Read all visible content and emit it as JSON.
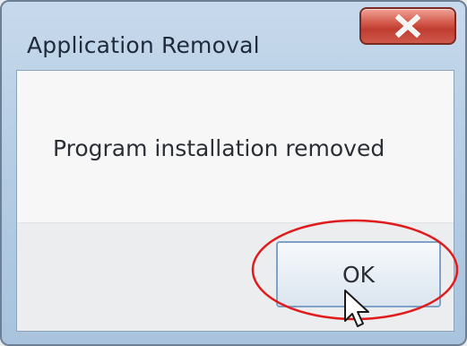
{
  "dialog": {
    "title": "Application Removal",
    "close_icon": "close-icon",
    "close_label": "X",
    "message": "Program installation removed",
    "ok_label": "OK"
  },
  "annotation": {
    "highlight": "red-ellipse-around-ok",
    "highlight_color": "#e01b1b"
  },
  "colors": {
    "close_button": "#c94437",
    "title_text": "#1f2a3a",
    "frame": "#b6cde4"
  }
}
